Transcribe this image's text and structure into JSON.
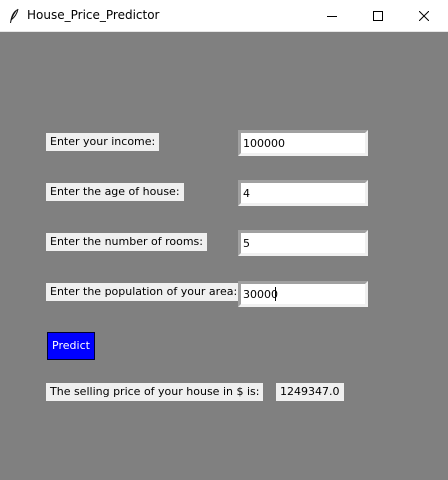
{
  "window": {
    "title": "House_Price_Predictor",
    "minimize_icon": "minimize-icon",
    "maximize_icon": "maximize-icon",
    "close_icon": "close-icon"
  },
  "form": {
    "fields": [
      {
        "label": "Enter your income:",
        "value": "100000"
      },
      {
        "label": "Enter the age of house:",
        "value": "4"
      },
      {
        "label": "Enter the number of rooms:",
        "value": "5"
      },
      {
        "label": "Enter the population of your area:",
        "value": "30000"
      }
    ],
    "predict_label": "Predict",
    "predict_color": "#0000ff",
    "result_label": "The selling price of your house in $ is:",
    "result_value": "1249347.0"
  },
  "colors": {
    "background": "#808080",
    "label_bg": "#f0f0f0"
  }
}
